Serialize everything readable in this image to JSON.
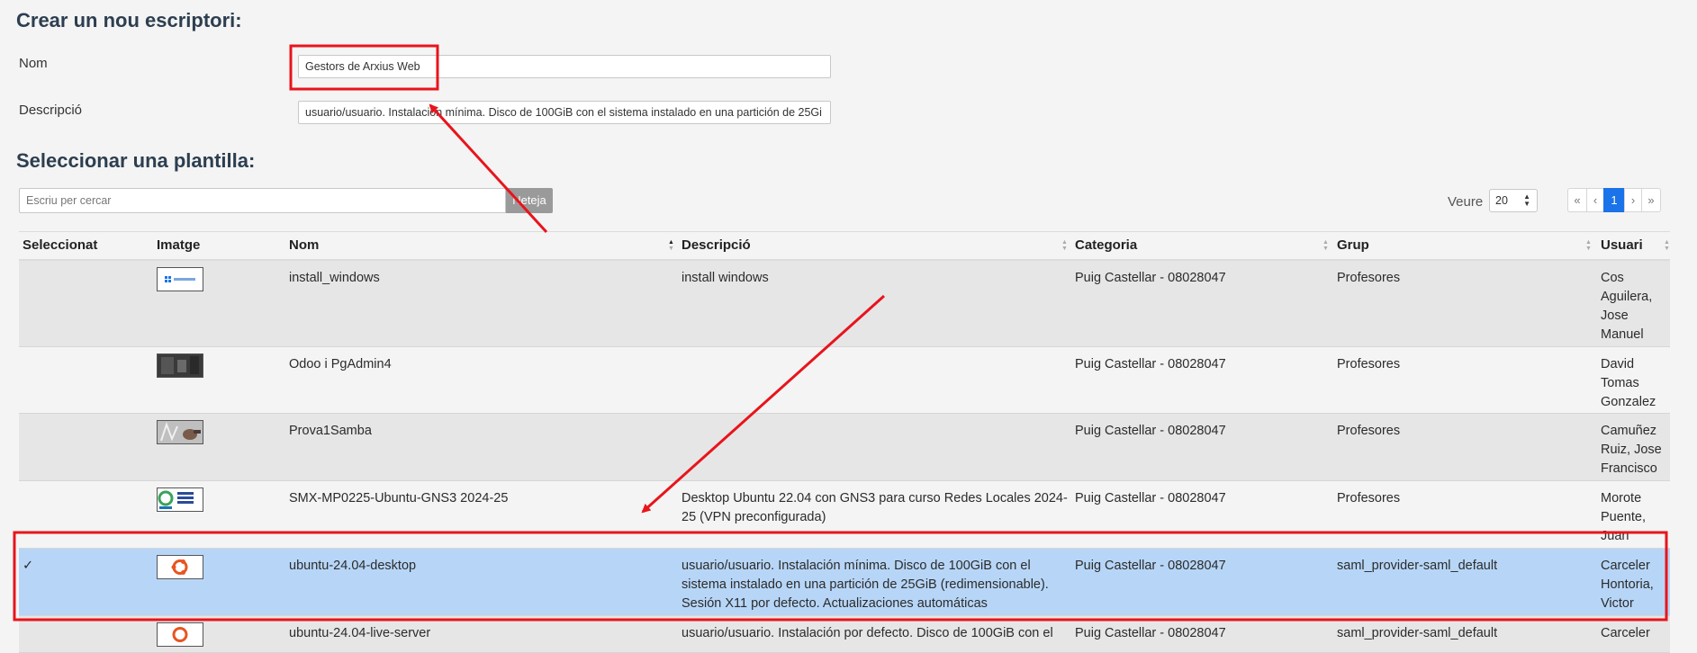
{
  "create": {
    "title": "Crear un nou escriptori:",
    "name_label": "Nom",
    "name_value": "Gestors de Arxius Web",
    "desc_label": "Descripció",
    "desc_value": "usuario/usuario. Instalación mínima. Disco de 100GiB con el sistema instalado en una partición de 25Gi"
  },
  "template": {
    "title": "Seleccionar una plantilla:",
    "search_placeholder": "Escriu per cercar",
    "clear_label": "Neteja",
    "per_page_label": "Veure",
    "per_page_value": "20",
    "pager": [
      "«",
      "‹",
      "1",
      "›",
      "»"
    ]
  },
  "table": {
    "columns": [
      "Seleccionat",
      "Imatge",
      "Nom",
      "Descripció",
      "Categoria",
      "Grup",
      "Usuari"
    ],
    "rows": [
      {
        "selected": "",
        "image": "windows-11-thumbnail",
        "name": "install_windows",
        "description": "install windows",
        "category": "Puig Castellar - 08028047",
        "group": "Profesores",
        "user": "Cos Aguilera, Jose Manuel"
      },
      {
        "selected": "",
        "image": "dark-photo-thumbnail",
        "name": "Odoo i PgAdmin4",
        "description": "",
        "category": "Puig Castellar - 08028047",
        "group": "Profesores",
        "user": "David Tomas Gonzalez"
      },
      {
        "selected": "",
        "image": "hand-photo-thumbnail",
        "name": "Prova1Samba",
        "description": "",
        "category": "Puig Castellar - 08028047",
        "group": "Profesores",
        "user": "Camuñez Ruiz, Jose Francisco"
      },
      {
        "selected": "",
        "image": "gns3-course-thumbnail",
        "name": "SMX-MP0225-Ubuntu-GNS3 2024-25",
        "description": "Desktop Ubuntu 22.04 con GNS3 para curso Redes Locales 2024-25 (VPN preconfigurada)",
        "category": "Puig Castellar - 08028047",
        "group": "Profesores",
        "user": "Morote Puente, Juan"
      },
      {
        "selected": "✓",
        "image": "ubuntu-logo-thumbnail",
        "name": "ubuntu-24.04-desktop",
        "description": "usuario/usuario. Instalación mínima. Disco de 100GiB con el sistema instalado en una partición de 25GiB (redimensionable). Sesión X11 por defecto. Actualizaciones automáticas desactivadas.",
        "category": "Puig Castellar - 08028047",
        "group": "saml_provider-saml_default",
        "user": "Carceler Hontoria, Victor"
      },
      {
        "selected": "",
        "image": "ubuntu-logo-thumbnail",
        "name": "ubuntu-24.04-live-server",
        "description": "usuario/usuario. Instalación por defecto. Disco de 100GiB con el",
        "category": "Puig Castellar - 08028047",
        "group": "saml_provider-saml_default",
        "user": "Carceler"
      }
    ]
  },
  "colors": {
    "annotation": "#e8141c",
    "selected_row": "#b7d6f7",
    "active_page": "#1a73e8"
  }
}
